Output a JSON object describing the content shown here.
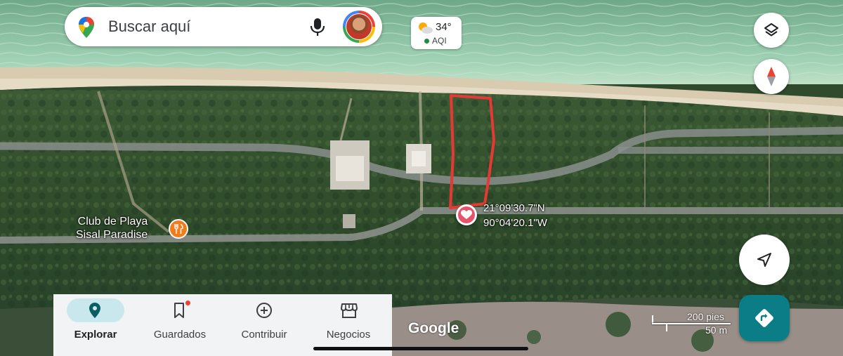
{
  "search": {
    "placeholder": "Buscar aquí"
  },
  "weather": {
    "temperature": "34°",
    "aqi_label": "AQI",
    "aqi_color": "#1e8e3e"
  },
  "dropped_pin": {
    "lat": "21°09'30.7\"N",
    "lng": "90°04'20.1\"W"
  },
  "poi": {
    "name_line1": "Club de Playa",
    "name_line2": "Sisal Paradise",
    "category_icon": "restaurant-icon",
    "color": "#f07c1b"
  },
  "bottom_nav": {
    "items": [
      {
        "label": "Explorar",
        "icon": "explore-pin-icon",
        "active": true
      },
      {
        "label": "Guardados",
        "icon": "bookmark-icon",
        "badge": true
      },
      {
        "label": "Contribuir",
        "icon": "add-circle-icon"
      },
      {
        "label": "Negocios",
        "icon": "storefront-icon"
      }
    ]
  },
  "attribution": {
    "logo_text": "Google"
  },
  "scale_bar": {
    "imperial": "200 pies",
    "metric": "50 m"
  },
  "colors": {
    "directions_button": "#0b7d86",
    "active_tab": "#c9e8ee",
    "highlight": "#e53935",
    "heart": "#e8536b"
  }
}
